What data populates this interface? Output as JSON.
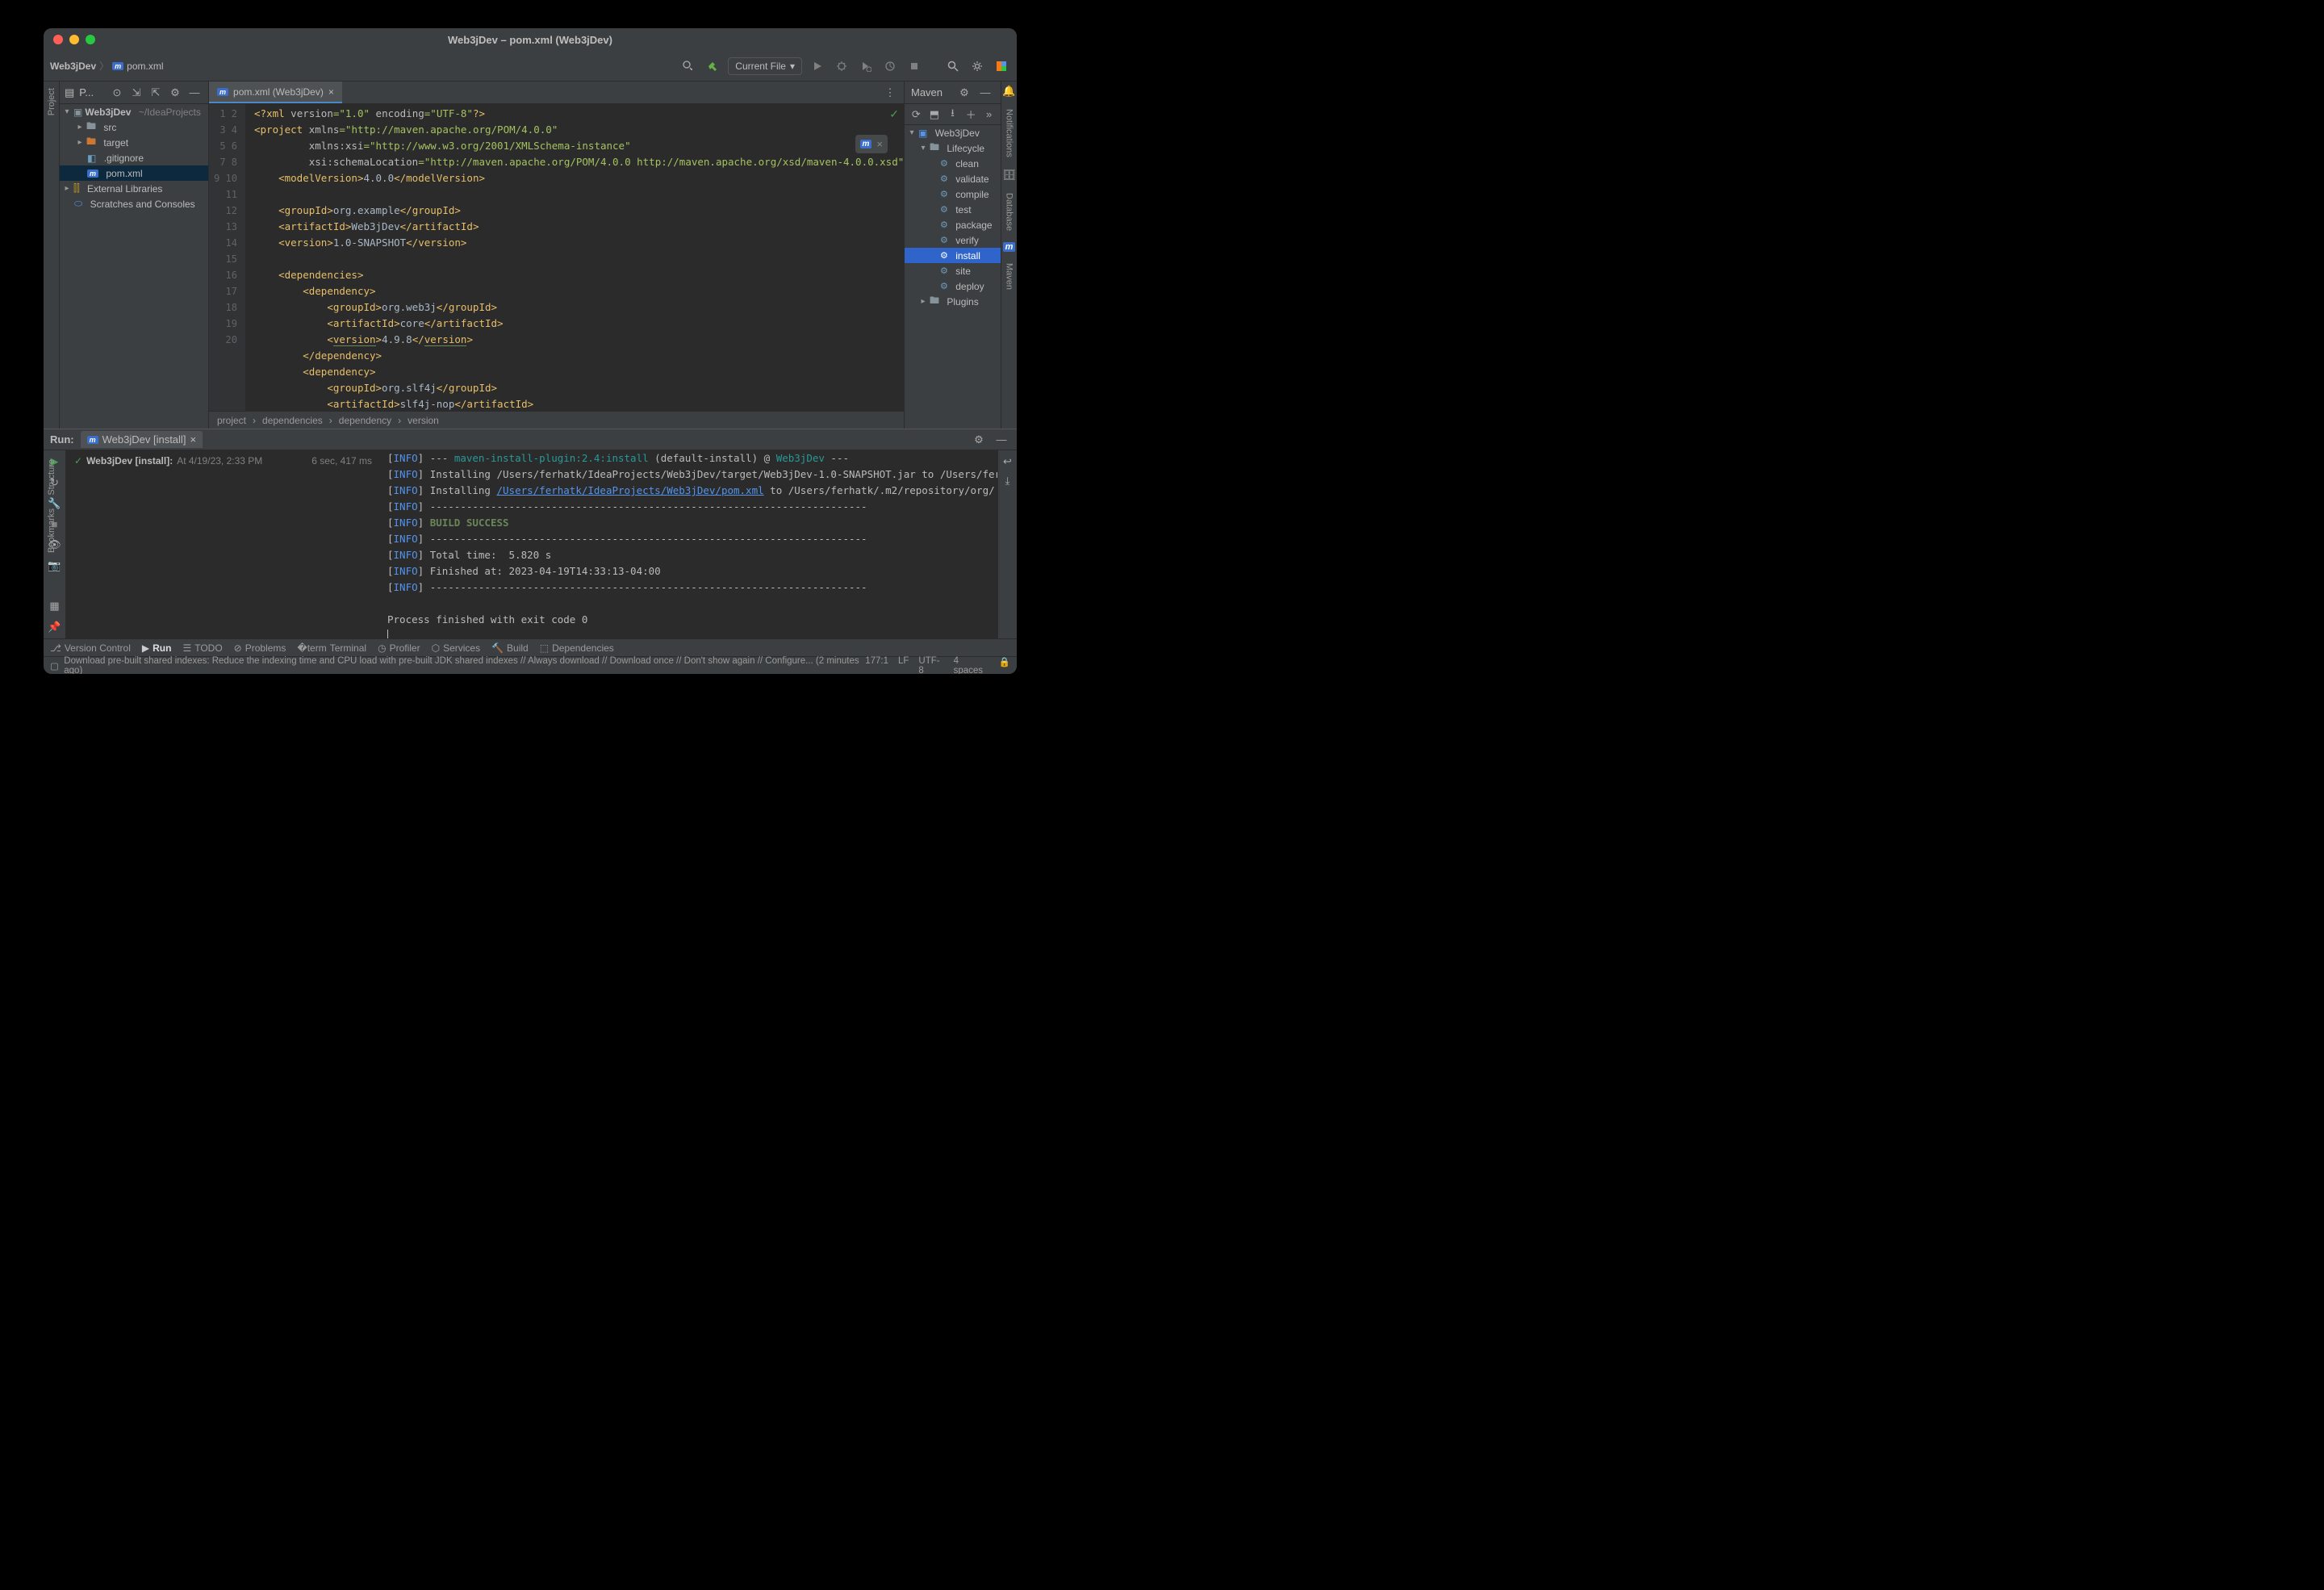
{
  "window": {
    "title": "Web3jDev – pom.xml (Web3jDev)"
  },
  "breadcrumbs": {
    "project": "Web3jDev",
    "file": "pom.xml"
  },
  "run_config": {
    "label": "Current File"
  },
  "project_panel": {
    "label": "P...",
    "root": "Web3jDev",
    "root_path": "~/IdeaProjects",
    "src": "src",
    "target": "target",
    "gitignore": ".gitignore",
    "pom": "pom.xml",
    "ext_lib": "External Libraries",
    "scratch": "Scratches and Consoles"
  },
  "editor_tab": {
    "label": "pom.xml (Web3jDev)"
  },
  "editor_crumbs": [
    "project",
    "dependencies",
    "dependency",
    "version"
  ],
  "code": {
    "lines": 20
  },
  "maven": {
    "title": "Maven",
    "root": "Web3jDev",
    "lifecycle": "Lifecycle",
    "phases": [
      "clean",
      "validate",
      "compile",
      "test",
      "package",
      "verify",
      "install",
      "site",
      "deploy"
    ],
    "selected": "install",
    "plugins": "Plugins"
  },
  "run": {
    "label": "Run:",
    "tab": "Web3jDev [install]",
    "tree_label": "Web3jDev [install]:",
    "tree_time": "At 4/19/23, 2:33 PM",
    "duration": "6 sec, 417 ms",
    "console": {
      "l1_pre": "--- ",
      "l1_plugin": "maven-install-plugin:2.4:install",
      "l1_post": " (default-install) @ ",
      "l1_proj": "Web3jDev",
      "l1_end": " ---",
      "l2": "Installing /Users/ferhatk/IdeaProjects/Web3jDev/target/Web3jDev-1.0-SNAPSHOT.jar to /Users/fer",
      "l3_pre": "Installing ",
      "l3_link": "/Users/ferhatk/IdeaProjects/Web3jDev/pom.xml",
      "l3_post": " to /Users/ferhatk/.m2/repository/org/",
      "dash": "------------------------------------------------------------------------",
      "build_success": "BUILD SUCCESS",
      "total_time": "Total time:  5.820 s",
      "finished": "Finished at: 2023-04-19T14:33:13-04:00",
      "exit": "Process finished with exit code 0"
    }
  },
  "bottom_tabs": {
    "vcs": "Version Control",
    "run": "Run",
    "todo": "TODO",
    "problems": "Problems",
    "terminal": "Terminal",
    "profiler": "Profiler",
    "services": "Services",
    "build": "Build",
    "dependencies": "Dependencies"
  },
  "status": {
    "msg": "Download pre-built shared indexes: Reduce the indexing time and CPU load with pre-built JDK shared indexes // Always download // Download once // Don't show again // Configure... (2 minutes ago)",
    "pos": "177:1",
    "le": "LF",
    "enc": "UTF-8",
    "indent": "4 spaces"
  },
  "left_rail": {
    "project": "Project",
    "structure": "Structure",
    "bookmarks": "Bookmarks"
  },
  "right_rail": {
    "notifications": "Notifications",
    "database": "Database",
    "maven_m": "m",
    "maven": "Maven"
  }
}
